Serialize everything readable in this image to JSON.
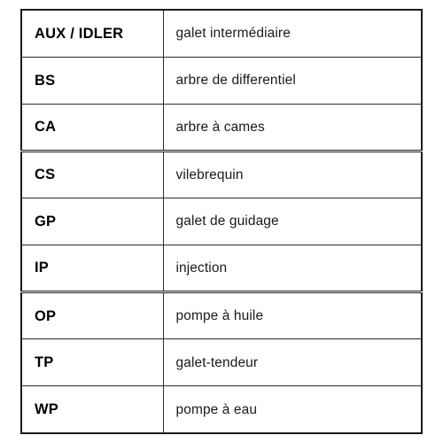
{
  "table": {
    "columns": [
      {
        "key": "code",
        "header": ""
      },
      {
        "key": "description",
        "header": ""
      }
    ],
    "rows": [
      {
        "code": "AUX / IDLER",
        "description": "galet intermédiaire",
        "group_start": false
      },
      {
        "code": "BS",
        "description": "arbre de differentiel",
        "group_start": false
      },
      {
        "code": "CA",
        "description": "arbre à cames",
        "group_start": false
      },
      {
        "code": "CS",
        "description": "vilebrequin",
        "group_start": true
      },
      {
        "code": "GP",
        "description": "galet de guidage",
        "group_start": false
      },
      {
        "code": "IP",
        "description": "injection",
        "group_start": false
      },
      {
        "code": "OP",
        "description": "pompe à huile",
        "group_start": true
      },
      {
        "code": "TP",
        "description": "galet-tendeur",
        "group_start": false
      },
      {
        "code": "WP",
        "description": "pompe à eau",
        "group_start": false
      }
    ]
  },
  "style": {
    "background": "#ffffff",
    "border_color": "#2b2b2b",
    "outer_border_color": "#1a1a1a",
    "text_color": "#000000",
    "description_color": "#1b1b1b"
  }
}
